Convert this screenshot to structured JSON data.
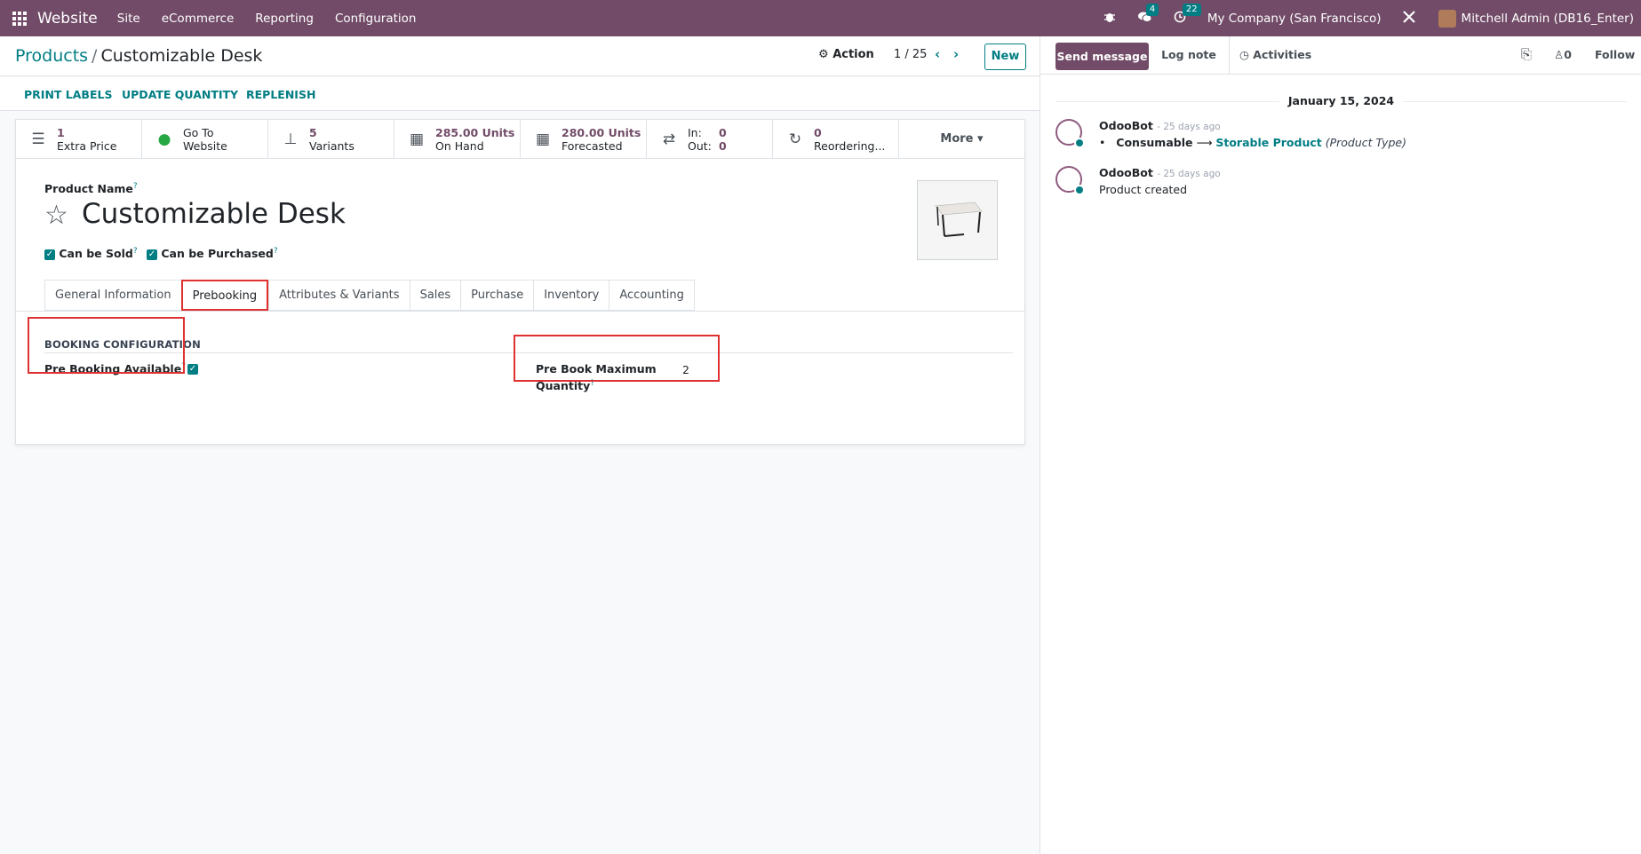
{
  "navbar": {
    "app": "Website",
    "menu": [
      "Site",
      "eCommerce",
      "Reporting",
      "Configuration"
    ],
    "messages_count": "4",
    "activities_count": "22",
    "company": "My Company (San Francisco)",
    "user": "Mitchell Admin (DB16_Enter)"
  },
  "breadcrumb": {
    "parent": "Products",
    "separator": "/",
    "current": "Customizable Desk"
  },
  "control": {
    "action": "Action",
    "pager": "1 / 25",
    "new": "New"
  },
  "statusbar": {
    "print_labels": "PRINT LABELS",
    "update_quantity": "UPDATE QUANTITY",
    "replenish": "REPLENISH"
  },
  "smart_buttons": {
    "extra_price": {
      "value": "1",
      "label": "Extra Price"
    },
    "website": {
      "line1": "Go To",
      "line2": "Website"
    },
    "variants": {
      "value": "5",
      "label": "Variants"
    },
    "on_hand": {
      "value": "285.00 Units",
      "label": "On Hand"
    },
    "forecasted": {
      "value": "280.00 Units",
      "label": "Forecasted"
    },
    "in_out": {
      "in_label": "In:",
      "in_value": "0",
      "out_label": "Out:",
      "out_value": "0"
    },
    "reordering": {
      "value": "0",
      "label": "Reordering..."
    },
    "more": "More"
  },
  "form": {
    "product_name_label": "Product Name",
    "product_name": "Customizable Desk",
    "can_be_sold": "Can be Sold",
    "can_be_purchased": "Can be Purchased",
    "help_mark": "?",
    "check": "✓"
  },
  "tabs": [
    "General Information",
    "Prebooking",
    "Attributes & Variants",
    "Sales",
    "Purchase",
    "Inventory",
    "Accounting"
  ],
  "prebooking": {
    "section_title": "BOOKING CONFIGURATION",
    "pre_booking_available": "Pre Booking Available",
    "max_qty_label_1": "Pre Book Maximum",
    "max_qty_label_2": "Quantity",
    "max_qty_value": "2"
  },
  "chatter": {
    "send_message": "Send message",
    "log_note": "Log note",
    "activities": "Activities",
    "followers_count": "0",
    "follow": "Follow",
    "date": "January 15, 2024",
    "messages": [
      {
        "author": "OdooBot",
        "ago": "- 25 days ago",
        "bullet": "•",
        "from": "Consumable",
        "arrow": "⟶",
        "to": "Storable Product",
        "field": "(Product Type)"
      },
      {
        "author": "OdooBot",
        "ago": "- 25 days ago",
        "body": "Product created"
      }
    ]
  }
}
